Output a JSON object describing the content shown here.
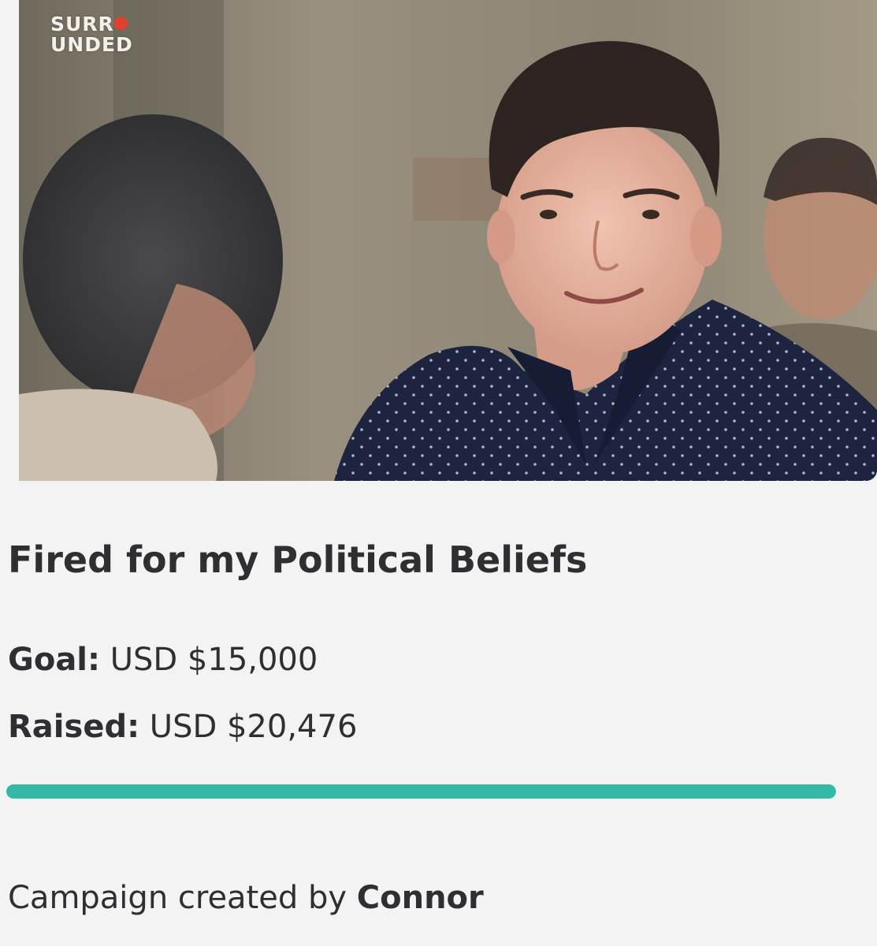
{
  "hero": {
    "logo_line1": "SURR",
    "logo_line2": "UNDED",
    "logo_dot_color": "#e23f2f"
  },
  "campaign": {
    "title": "Fired for my Political Beliefs",
    "goal_label": "Goal:",
    "goal_value": "USD $15,000",
    "raised_label": "Raised:",
    "raised_value": "USD $20,476",
    "progress_fraction": 1.0,
    "progress_color": "#33b9a5",
    "creator_prefix": "Campaign created by",
    "creator_name": "Connor"
  }
}
